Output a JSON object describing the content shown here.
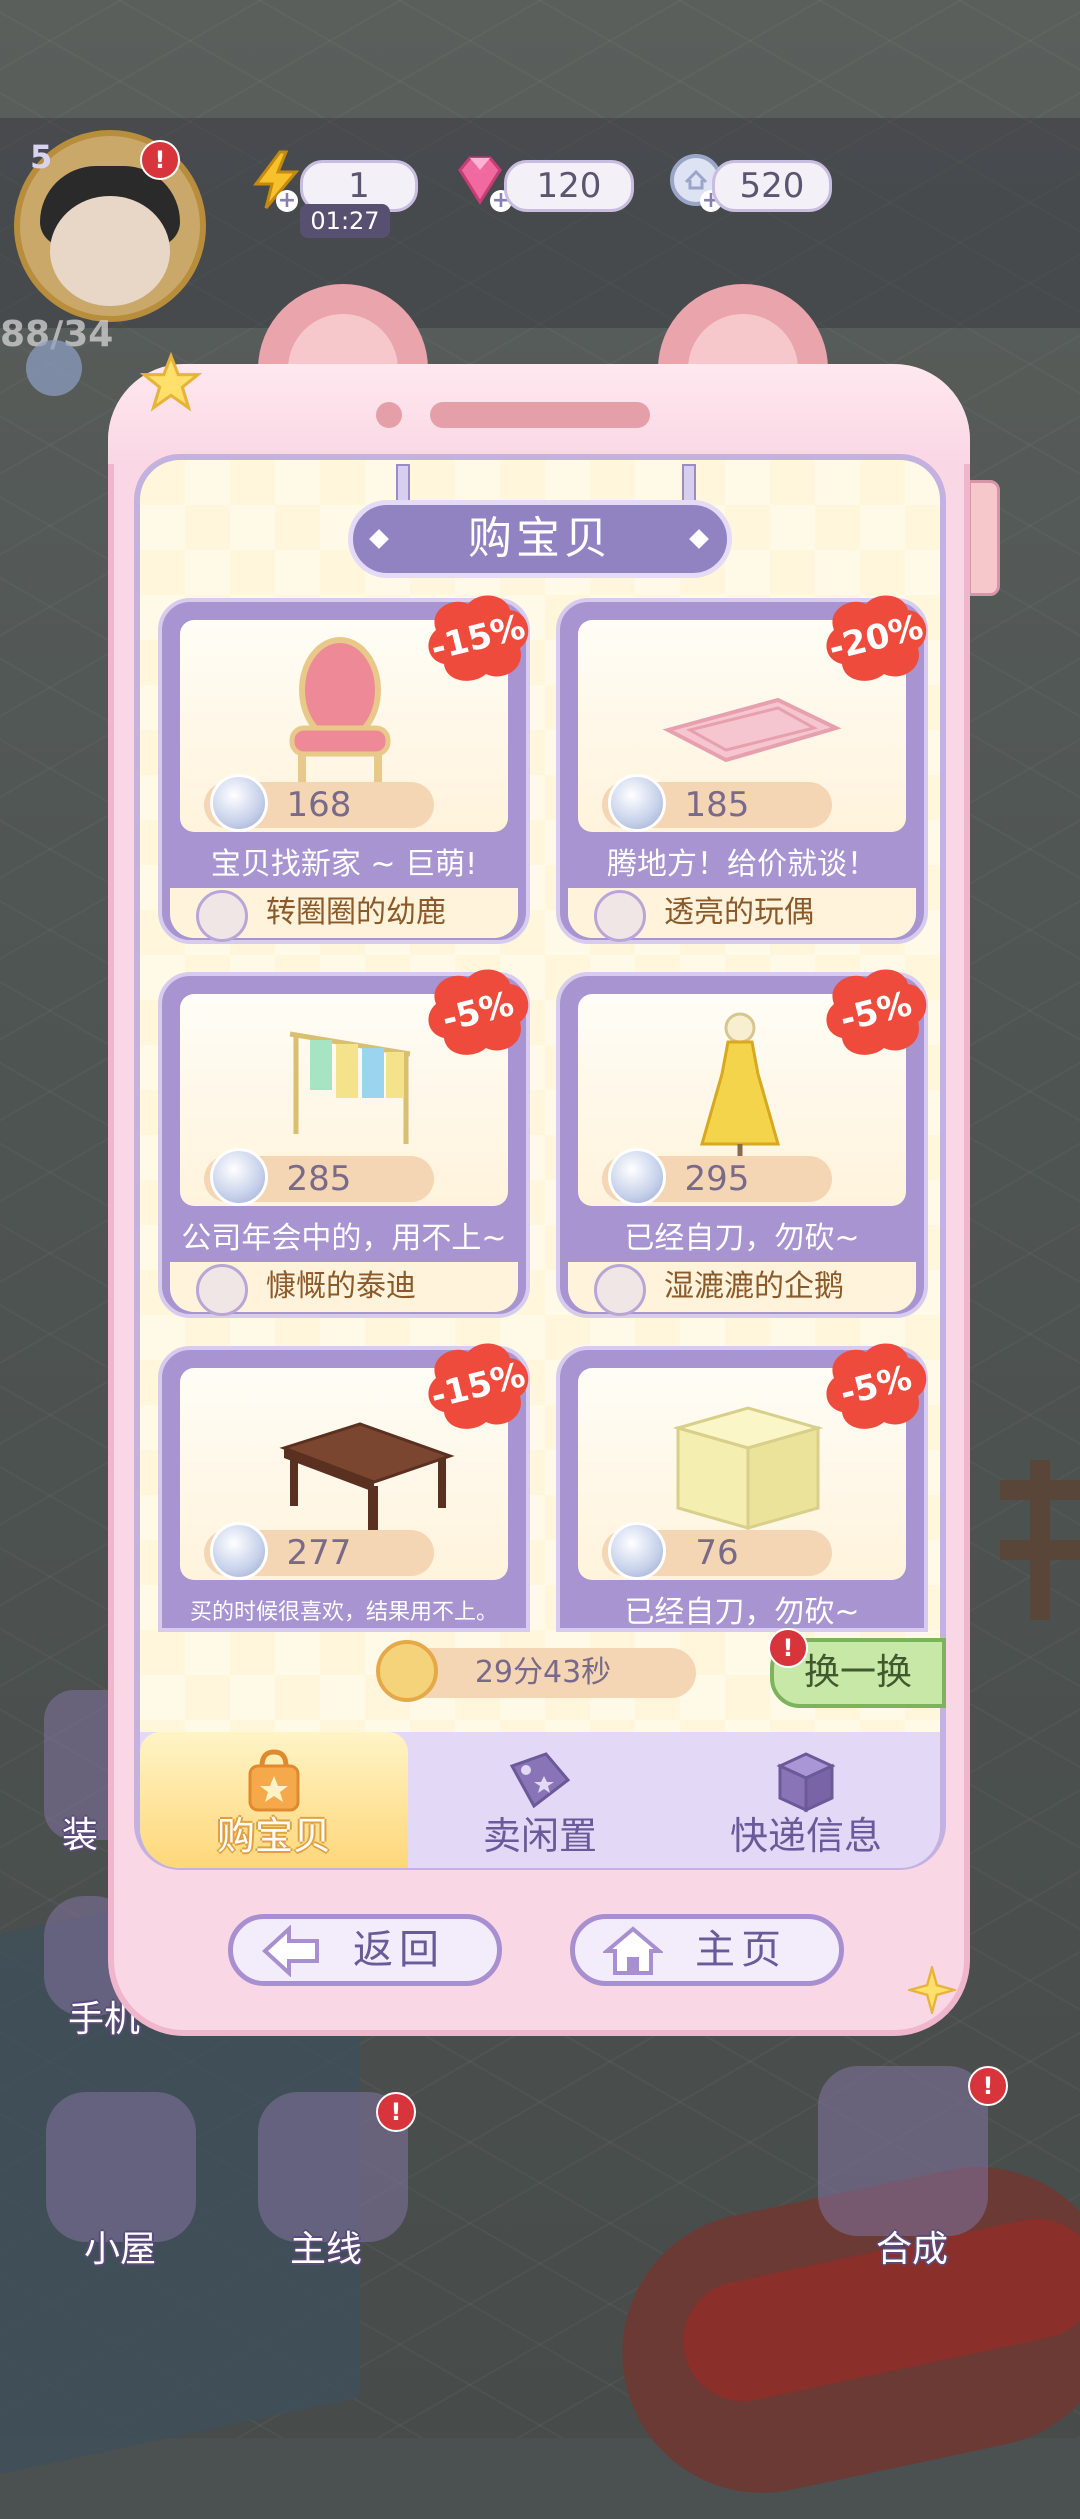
{
  "player": {
    "level": "5",
    "hp_text": "88/34"
  },
  "resources": {
    "energy": "1",
    "energy_timer": "01:27",
    "gems": "120",
    "coins": "520"
  },
  "shop": {
    "title": "购宝贝",
    "items": [
      {
        "discount": "-15%",
        "price": "168",
        "description": "宝贝找新家 ~ 巨萌!",
        "seller": "转圈圈的幼鹿"
      },
      {
        "discount": "-20%",
        "price": "185",
        "description": "腾地方！给价就谈！",
        "seller": "透亮的玩偶"
      },
      {
        "discount": "-5%",
        "price": "285",
        "description": "公司年会中的，用不上~",
        "seller": "慷慨的泰迪"
      },
      {
        "discount": "-5%",
        "price": "295",
        "description": "已经自刀，勿砍~",
        "seller": "湿漉漉的企鹅"
      },
      {
        "discount": "-15%",
        "price": "277",
        "description": "买的时候很喜欢，结果用不上。",
        "seller": ""
      },
      {
        "discount": "-5%",
        "price": "76",
        "description": "已经自刀，勿砍~",
        "seller": ""
      }
    ],
    "refresh_timer": "29分43秒",
    "swap_label": "换一换"
  },
  "tabs": [
    {
      "label": "购宝贝",
      "icon": "shopping-bag-icon"
    },
    {
      "label": "卖闲置",
      "icon": "price-tag-icon"
    },
    {
      "label": "快递信息",
      "icon": "package-icon"
    }
  ],
  "buttons": {
    "back": "返回",
    "home": "主页"
  },
  "background_nav": {
    "decor": "装",
    "phone": "手机",
    "house": "小屋",
    "main": "主线",
    "merge": "合成"
  },
  "colors": {
    "accent": "#a894d0",
    "discount_badge": "#ef4b3c",
    "frame": "#f9d7e4"
  }
}
